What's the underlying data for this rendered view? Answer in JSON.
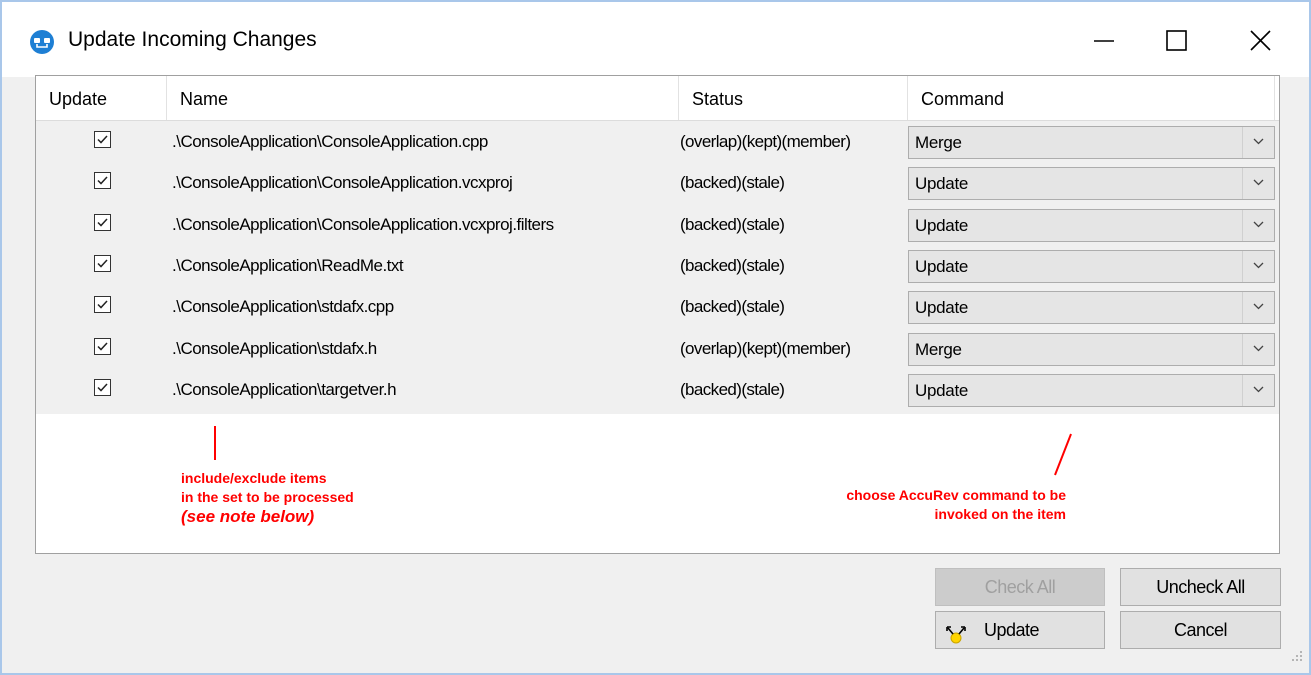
{
  "window": {
    "title": "Update Incoming Changes",
    "icon": "accurev-app-icon",
    "controls": [
      "minimize-icon",
      "maximize-icon",
      "close-icon"
    ]
  },
  "table": {
    "headers": {
      "update": "Update",
      "name": "Name",
      "status": "Status",
      "command": "Command"
    },
    "rows": [
      {
        "checked": true,
        "name": ".\\ConsoleApplication\\ConsoleApplication.cpp",
        "status": "(overlap)(kept)(member)",
        "command": "Merge"
      },
      {
        "checked": true,
        "name": ".\\ConsoleApplication\\ConsoleApplication.vcxproj",
        "status": "(backed)(stale)",
        "command": "Update"
      },
      {
        "checked": true,
        "name": ".\\ConsoleApplication\\ConsoleApplication.vcxproj.filters",
        "status": "(backed)(stale)",
        "command": "Update"
      },
      {
        "checked": true,
        "name": ".\\ConsoleApplication\\ReadMe.txt",
        "status": "(backed)(stale)",
        "command": "Update"
      },
      {
        "checked": true,
        "name": ".\\ConsoleApplication\\stdafx.cpp",
        "status": "(backed)(stale)",
        "command": "Update"
      },
      {
        "checked": true,
        "name": ".\\ConsoleApplication\\stdafx.h",
        "status": "(overlap)(kept)(member)",
        "command": "Merge"
      },
      {
        "checked": true,
        "name": ".\\ConsoleApplication\\targetver.h",
        "status": "(backed)(stale)",
        "command": "Update"
      }
    ]
  },
  "annotations": {
    "left_line1": "include/exclude items",
    "left_line2": "in the set to be processed",
    "left_note": "(see note below)",
    "right_line1": "choose AccuRev command to be",
    "right_line2": "invoked on the item",
    "color": "#ff0000"
  },
  "buttons": {
    "check_all": "Check All",
    "uncheck_all": "Uncheck All",
    "update": "Update",
    "cancel": "Cancel"
  }
}
